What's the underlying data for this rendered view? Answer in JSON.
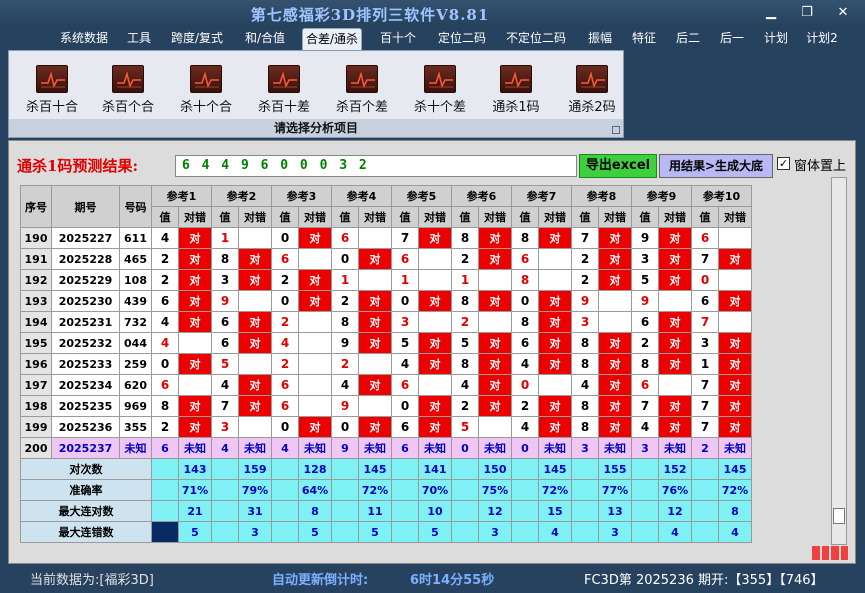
{
  "window": {
    "title": "第七感福彩3D排列三软件V8.81"
  },
  "menu": [
    "系统数据",
    "工具",
    "跨度/复式",
    "和/合值",
    "合差/通杀",
    "百十个",
    "定位二码",
    "不定位二码",
    "振幅",
    "特征",
    "后二",
    "后一",
    "计划",
    "计划2"
  ],
  "ribbon": {
    "items": [
      "杀百十合",
      "杀百个合",
      "杀十个合",
      "杀百十差",
      "杀百个差",
      "杀十个差",
      "通杀1码",
      "通杀2码"
    ],
    "caption": "请选择分析项目"
  },
  "prediction": {
    "label": "通杀1码预测结果:",
    "value": "6 4 4 9 6 0 0 0 3 2",
    "export_button": "导出excel",
    "big_button": "用结果>生成大底",
    "on_top_label": "窗体置上",
    "on_top_checked": true
  },
  "table": {
    "h_seq": "序号",
    "h_issue": "期号",
    "h_num": "号码",
    "refs": [
      "参考1",
      "参考2",
      "参考3",
      "参考4",
      "参考5",
      "参考6",
      "参考7",
      "参考8",
      "参考9",
      "参考10"
    ],
    "sub_val": "值",
    "sub_res": "对错",
    "hit": "对",
    "unknown": "未知",
    "rows": [
      {
        "seq": "190",
        "issue": "2025227",
        "num": "611",
        "refs": [
          [
            "4",
            1,
            0
          ],
          [
            "1",
            0,
            1
          ],
          [
            "0",
            1,
            0
          ],
          [
            "6",
            0,
            1
          ],
          [
            "7",
            1,
            0
          ],
          [
            "8",
            1,
            0
          ],
          [
            "8",
            1,
            0
          ],
          [
            "7",
            1,
            0
          ],
          [
            "9",
            1,
            0
          ],
          [
            "6",
            0,
            1
          ]
        ]
      },
      {
        "seq": "191",
        "issue": "2025228",
        "num": "465",
        "refs": [
          [
            "2",
            1,
            0
          ],
          [
            "8",
            1,
            0
          ],
          [
            "6",
            0,
            1
          ],
          [
            "0",
            1,
            0
          ],
          [
            "6",
            0,
            1
          ],
          [
            "2",
            1,
            0
          ],
          [
            "6",
            0,
            1
          ],
          [
            "2",
            1,
            0
          ],
          [
            "3",
            1,
            0
          ],
          [
            "7",
            1,
            0
          ]
        ]
      },
      {
        "seq": "192",
        "issue": "2025229",
        "num": "108",
        "refs": [
          [
            "2",
            1,
            0
          ],
          [
            "3",
            1,
            0
          ],
          [
            "2",
            1,
            0
          ],
          [
            "1",
            0,
            1
          ],
          [
            "1",
            0,
            1
          ],
          [
            "1",
            0,
            1
          ],
          [
            "8",
            0,
            1
          ],
          [
            "2",
            1,
            0
          ],
          [
            "5",
            1,
            0
          ],
          [
            "0",
            0,
            1
          ]
        ]
      },
      {
        "seq": "193",
        "issue": "2025230",
        "num": "439",
        "refs": [
          [
            "6",
            1,
            0
          ],
          [
            "9",
            0,
            1
          ],
          [
            "0",
            1,
            0
          ],
          [
            "2",
            1,
            0
          ],
          [
            "0",
            1,
            0
          ],
          [
            "8",
            1,
            0
          ],
          [
            "0",
            1,
            0
          ],
          [
            "9",
            0,
            1
          ],
          [
            "9",
            0,
            1
          ],
          [
            "6",
            1,
            0
          ]
        ]
      },
      {
        "seq": "194",
        "issue": "2025231",
        "num": "732",
        "refs": [
          [
            "4",
            1,
            0
          ],
          [
            "6",
            1,
            0
          ],
          [
            "2",
            0,
            1
          ],
          [
            "8",
            1,
            0
          ],
          [
            "3",
            0,
            1
          ],
          [
            "2",
            0,
            1
          ],
          [
            "8",
            1,
            0
          ],
          [
            "3",
            0,
            1
          ],
          [
            "6",
            1,
            0
          ],
          [
            "7",
            0,
            1
          ]
        ]
      },
      {
        "seq": "195",
        "issue": "2025232",
        "num": "044",
        "refs": [
          [
            "4",
            0,
            1
          ],
          [
            "6",
            1,
            0
          ],
          [
            "4",
            0,
            1
          ],
          [
            "9",
            1,
            0
          ],
          [
            "5",
            1,
            0
          ],
          [
            "5",
            1,
            0
          ],
          [
            "6",
            1,
            0
          ],
          [
            "8",
            1,
            0
          ],
          [
            "2",
            1,
            0
          ],
          [
            "3",
            1,
            0
          ]
        ]
      },
      {
        "seq": "196",
        "issue": "2025233",
        "num": "259",
        "refs": [
          [
            "0",
            1,
            0
          ],
          [
            "5",
            0,
            1
          ],
          [
            "2",
            0,
            1
          ],
          [
            "2",
            0,
            1
          ],
          [
            "4",
            1,
            0
          ],
          [
            "8",
            1,
            0
          ],
          [
            "4",
            1,
            0
          ],
          [
            "8",
            1,
            0
          ],
          [
            "8",
            1,
            0
          ],
          [
            "1",
            1,
            0
          ]
        ]
      },
      {
        "seq": "197",
        "issue": "2025234",
        "num": "620",
        "refs": [
          [
            "6",
            0,
            1
          ],
          [
            "4",
            1,
            0
          ],
          [
            "6",
            0,
            1
          ],
          [
            "4",
            1,
            0
          ],
          [
            "6",
            0,
            1
          ],
          [
            "4",
            1,
            0
          ],
          [
            "0",
            0,
            1
          ],
          [
            "4",
            1,
            0
          ],
          [
            "6",
            0,
            1
          ],
          [
            "7",
            1,
            0
          ]
        ]
      },
      {
        "seq": "198",
        "issue": "2025235",
        "num": "969",
        "refs": [
          [
            "8",
            1,
            0
          ],
          [
            "7",
            1,
            0
          ],
          [
            "6",
            0,
            1
          ],
          [
            "9",
            0,
            1
          ],
          [
            "0",
            1,
            0
          ],
          [
            "2",
            1,
            0
          ],
          [
            "2",
            1,
            0
          ],
          [
            "8",
            1,
            0
          ],
          [
            "7",
            1,
            0
          ],
          [
            "7",
            1,
            0
          ]
        ]
      },
      {
        "seq": "199",
        "issue": "2025236",
        "num": "355",
        "refs": [
          [
            "2",
            1,
            0
          ],
          [
            "3",
            0,
            1
          ],
          [
            "0",
            1,
            0
          ],
          [
            "0",
            1,
            0
          ],
          [
            "6",
            1,
            0
          ],
          [
            "5",
            0,
            1
          ],
          [
            "4",
            1,
            0
          ],
          [
            "8",
            1,
            0
          ],
          [
            "4",
            1,
            0
          ],
          [
            "7",
            1,
            0
          ]
        ]
      }
    ],
    "pending": {
      "seq": "200",
      "issue": "2025237",
      "num": "未知",
      "vals": [
        "6",
        "4",
        "4",
        "9",
        "6",
        "0",
        "0",
        "3",
        "3",
        "2"
      ]
    },
    "stats": [
      {
        "label": "对次数",
        "vals": [
          "143",
          "159",
          "128",
          "145",
          "141",
          "150",
          "145",
          "155",
          "152",
          "145"
        ]
      },
      {
        "label": "准确率",
        "vals": [
          "71%",
          "79%",
          "64%",
          "72%",
          "70%",
          "75%",
          "72%",
          "77%",
          "76%",
          "72%"
        ]
      },
      {
        "label": "最大连对数",
        "vals": [
          "21",
          "31",
          "8",
          "11",
          "10",
          "12",
          "15",
          "13",
          "12",
          "8"
        ]
      },
      {
        "label": "最大连错数",
        "vals": [
          "5",
          "3",
          "5",
          "5",
          "5",
          "3",
          "4",
          "3",
          "4",
          "4"
        ]
      }
    ]
  },
  "status": {
    "current": "当前数据为:[福彩3D]",
    "countdown_label": "自动更新倒计时:",
    "countdown": "6时14分55秒",
    "issue_text": "FC3D第 2025236 期开:【355】【746】"
  },
  "colors": {
    "hit": "#ec0000",
    "pending": "#f0c6f4",
    "stats": "#7ff0f4",
    "title": "#9fc4ff"
  },
  "icons": {
    "window": [
      "minimize-icon",
      "restore-icon",
      "close-icon"
    ],
    "ribbon": "chart-trend-icon"
  }
}
